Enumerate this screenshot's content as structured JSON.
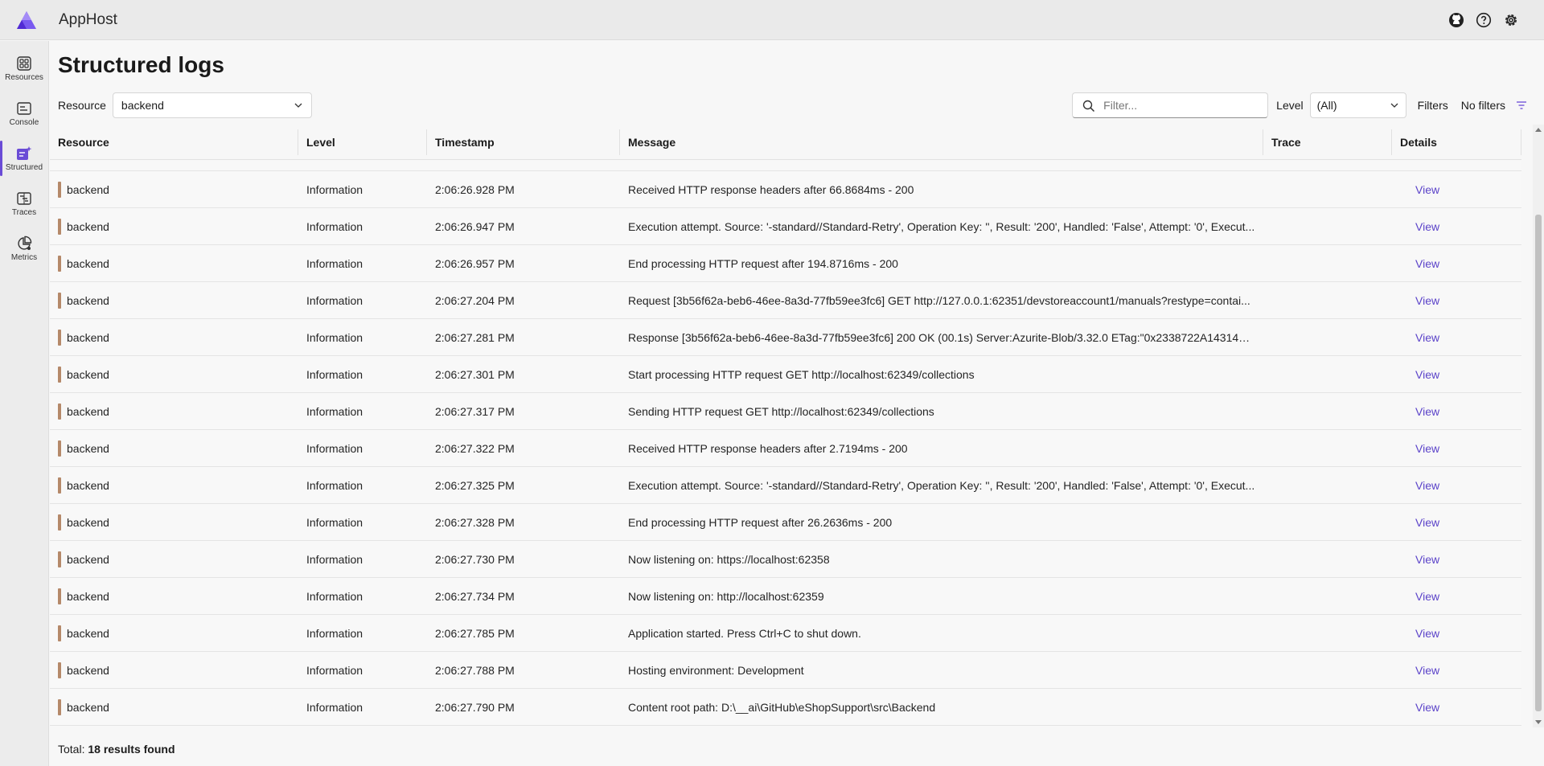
{
  "header": {
    "app_title": "AppHost",
    "icons": [
      "github-icon",
      "help-icon",
      "settings-icon"
    ]
  },
  "sidebar": {
    "items": [
      {
        "label": "Resources",
        "icon": "resources-grid-icon",
        "active": false
      },
      {
        "label": "Console",
        "icon": "console-icon",
        "active": false
      },
      {
        "label": "Structured",
        "icon": "structured-logs-icon",
        "active": true
      },
      {
        "label": "Traces",
        "icon": "traces-icon",
        "active": false
      },
      {
        "label": "Metrics",
        "icon": "metrics-icon",
        "active": false
      }
    ]
  },
  "page": {
    "title": "Structured logs",
    "resource_label": "Resource",
    "resource_value": "backend",
    "filter_placeholder": "Filter...",
    "level_label": "Level",
    "level_value": "(All)",
    "filters_label": "Filters",
    "no_filters_label": "No filters"
  },
  "colors": {
    "accent": "#6a4bd6",
    "resource_bar": "#b5896a",
    "link": "#5b43c9"
  },
  "table": {
    "columns": [
      "Resource",
      "Level",
      "Timestamp",
      "Message",
      "Trace",
      "Details"
    ],
    "rows": [
      {
        "resource": "backend",
        "level": "Information",
        "timestamp": "2:06:26.928 PM",
        "message": "Received HTTP response headers after 66.8684ms - 200",
        "trace": "",
        "details": "View"
      },
      {
        "resource": "backend",
        "level": "Information",
        "timestamp": "2:06:26.947 PM",
        "message": "Execution attempt. Source: '-standard//Standard-Retry', Operation Key: '', Result: '200', Handled: 'False', Attempt: '0', Execut...",
        "trace": "",
        "details": "View"
      },
      {
        "resource": "backend",
        "level": "Information",
        "timestamp": "2:06:26.957 PM",
        "message": "End processing HTTP request after 194.8716ms - 200",
        "trace": "",
        "details": "View"
      },
      {
        "resource": "backend",
        "level": "Information",
        "timestamp": "2:06:27.204 PM",
        "message": "Request [3b56f62a-beb6-46ee-8a3d-77fb59ee3fc6] GET http://127.0.0.1:62351/devstoreaccount1/manuals?restype=contai...",
        "trace": "",
        "details": "View"
      },
      {
        "resource": "backend",
        "level": "Information",
        "timestamp": "2:06:27.281 PM",
        "message": "Response [3b56f62a-beb6-46ee-8a3d-77fb59ee3fc6] 200 OK (00.1s) Server:Azurite-Blob/3.32.0 ETag:\"0x2338722A1431400...",
        "trace": "",
        "details": "View"
      },
      {
        "resource": "backend",
        "level": "Information",
        "timestamp": "2:06:27.301 PM",
        "message": "Start processing HTTP request GET http://localhost:62349/collections",
        "trace": "",
        "details": "View"
      },
      {
        "resource": "backend",
        "level": "Information",
        "timestamp": "2:06:27.317 PM",
        "message": "Sending HTTP request GET http://localhost:62349/collections",
        "trace": "",
        "details": "View"
      },
      {
        "resource": "backend",
        "level": "Information",
        "timestamp": "2:06:27.322 PM",
        "message": "Received HTTP response headers after 2.7194ms - 200",
        "trace": "",
        "details": "View"
      },
      {
        "resource": "backend",
        "level": "Information",
        "timestamp": "2:06:27.325 PM",
        "message": "Execution attempt. Source: '-standard//Standard-Retry', Operation Key: '', Result: '200', Handled: 'False', Attempt: '0', Execut...",
        "trace": "",
        "details": "View"
      },
      {
        "resource": "backend",
        "level": "Information",
        "timestamp": "2:06:27.328 PM",
        "message": "End processing HTTP request after 26.2636ms - 200",
        "trace": "",
        "details": "View"
      },
      {
        "resource": "backend",
        "level": "Information",
        "timestamp": "2:06:27.730 PM",
        "message": "Now listening on: https://localhost:62358",
        "trace": "",
        "details": "View"
      },
      {
        "resource": "backend",
        "level": "Information",
        "timestamp": "2:06:27.734 PM",
        "message": "Now listening on: http://localhost:62359",
        "trace": "",
        "details": "View"
      },
      {
        "resource": "backend",
        "level": "Information",
        "timestamp": "2:06:27.785 PM",
        "message": "Application started. Press Ctrl+C to shut down.",
        "trace": "",
        "details": "View"
      },
      {
        "resource": "backend",
        "level": "Information",
        "timestamp": "2:06:27.788 PM",
        "message": "Hosting environment: Development",
        "trace": "",
        "details": "View"
      },
      {
        "resource": "backend",
        "level": "Information",
        "timestamp": "2:06:27.790 PM",
        "message": "Content root path: D:\\__ai\\GitHub\\eShopSupport\\src\\Backend",
        "trace": "",
        "details": "View"
      }
    ]
  },
  "footer": {
    "total_label": "Total:",
    "results_text": "18 results found"
  }
}
